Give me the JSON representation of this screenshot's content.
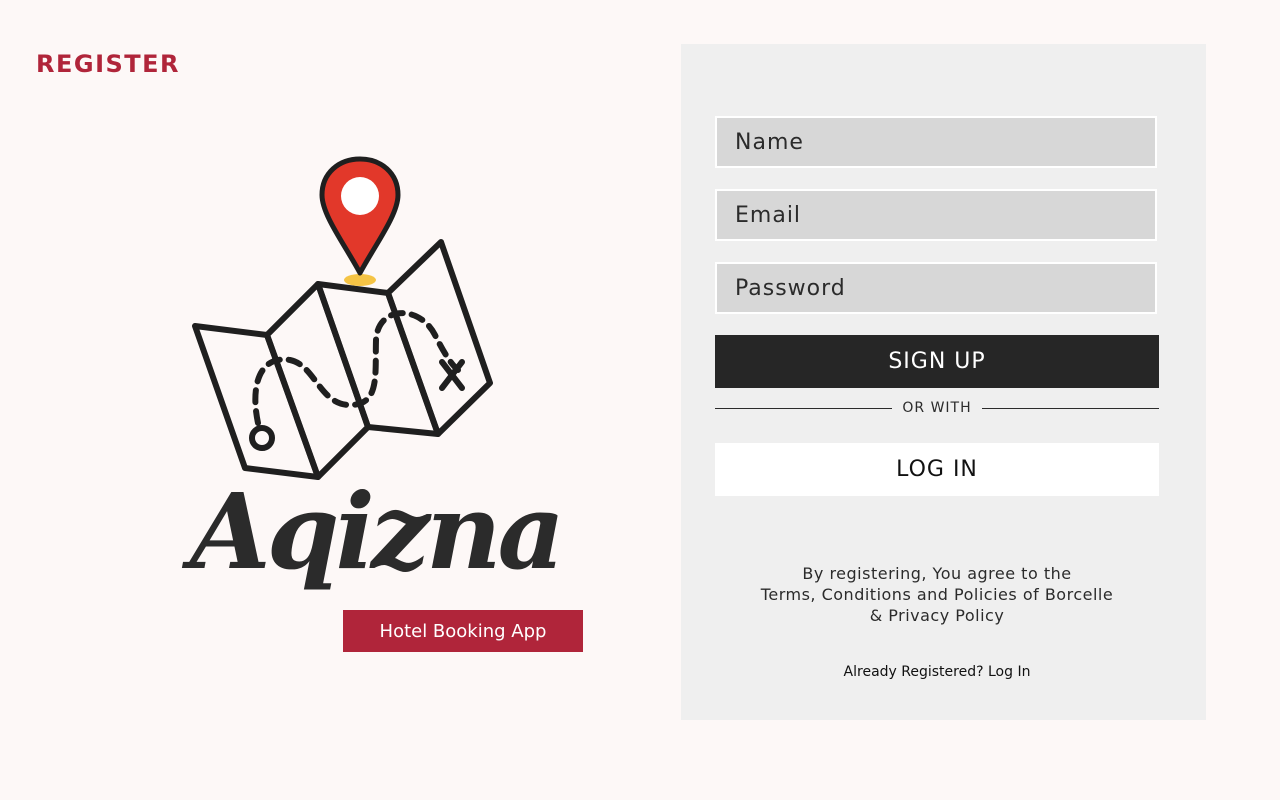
{
  "page": {
    "heading": "REGISTER"
  },
  "brand": {
    "wordmark": "Aqizna",
    "tagline": "Hotel Booking App",
    "logo_icon": "folded-map-with-location-pin",
    "colors": {
      "accent": "#b0253a",
      "pin": "#e2382a",
      "pin_base": "#f5c445",
      "ink": "#2b2b2b"
    }
  },
  "form": {
    "name_placeholder": "Name",
    "email_placeholder": "Email",
    "password_placeholder": "Password",
    "signup_label": "SIGN UP",
    "divider_label": "OR WITH",
    "login_label": "LOG IN",
    "terms_line1": "By registering, You agree to the",
    "terms_line2": "Terms, Conditions and Policies of Borcelle",
    "terms_line3": "& Privacy Policy",
    "already_registered": "Already Registered? Log In"
  }
}
